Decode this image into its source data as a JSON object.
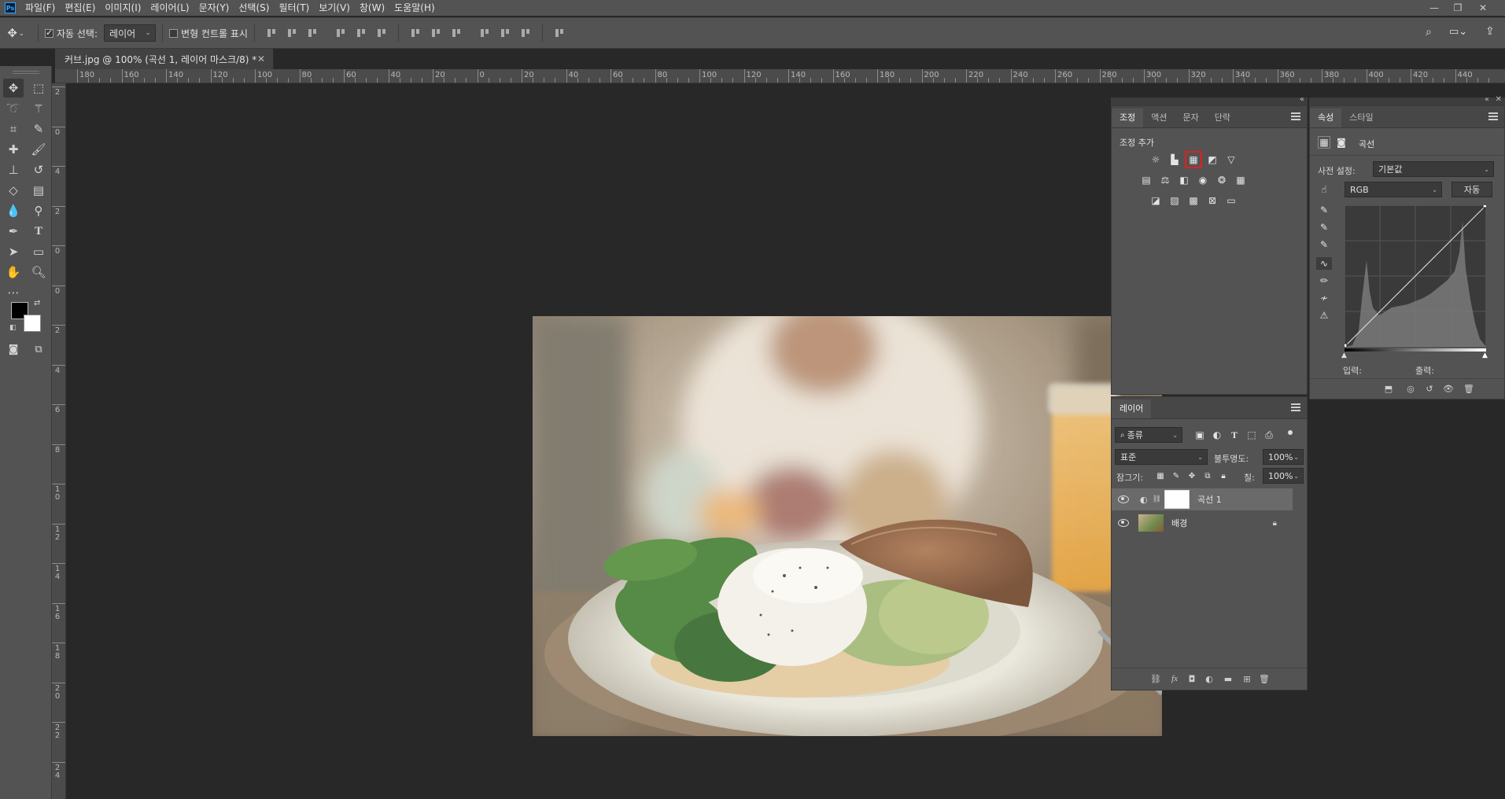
{
  "app": {
    "logo": "Ps"
  },
  "menubar": {
    "items": [
      {
        "label": "파일(F)"
      },
      {
        "label": "편집(E)"
      },
      {
        "label": "이미지(I)"
      },
      {
        "label": "레이어(L)"
      },
      {
        "label": "문자(Y)"
      },
      {
        "label": "선택(S)"
      },
      {
        "label": "필터(T)"
      },
      {
        "label": "보기(V)"
      },
      {
        "label": "창(W)"
      },
      {
        "label": "도움말(H)"
      }
    ]
  },
  "optionsbar": {
    "auto_select_label": "자동 선택:",
    "auto_select_checked": true,
    "auto_select_target": "레이어",
    "transform_controls_label": "변형 컨트롤 표시",
    "transform_controls_checked": false
  },
  "document_tab": {
    "title": "커브.jpg @ 100% (곡선 1, 레이어 마스크/8) *"
  },
  "ruler_h": {
    "labels": [
      "180",
      "160",
      "140",
      "120",
      "100",
      "80",
      "60",
      "40",
      "20",
      "0",
      "20",
      "40",
      "60",
      "80",
      "100",
      "120",
      "140",
      "160",
      "180",
      "200",
      "220",
      "240",
      "260",
      "280",
      "300",
      "320",
      "340",
      "360",
      "380",
      "400",
      "420",
      "440"
    ]
  },
  "ruler_v": {
    "labels": [
      "2",
      "0",
      "4",
      "2",
      "0",
      "0",
      "2",
      "4",
      "6",
      "8",
      "10",
      "12",
      "14",
      "16",
      "18",
      "20",
      "22",
      "24"
    ]
  },
  "adjustments_panel": {
    "tabs": [
      {
        "label": "조정",
        "active": true
      },
      {
        "label": "액션",
        "active": false
      },
      {
        "label": "문자",
        "active": false
      },
      {
        "label": "단락",
        "active": false
      }
    ],
    "heading": "조정 추가",
    "selected_icon": "curves-icon"
  },
  "properties_panel": {
    "tabs": [
      {
        "label": "속성",
        "active": true
      },
      {
        "label": "스타일",
        "active": false
      }
    ],
    "type_label": "곡선",
    "preset_label": "사전 설정:",
    "preset_value": "기본값",
    "channel_value": "RGB",
    "auto_button": "자동",
    "input_label": "입력:",
    "output_label": "출력:"
  },
  "layers_panel": {
    "tab": "레이어",
    "filter_kind": "종류",
    "blend_mode": "표준",
    "opacity_label": "불투명도:",
    "opacity_value": "100%",
    "lock_label": "잠그기:",
    "fill_label": "칠:",
    "fill_value": "100%",
    "layers": [
      {
        "name": "곡선 1",
        "selected": true,
        "locked": false
      },
      {
        "name": "배경",
        "selected": false,
        "locked": true
      }
    ]
  },
  "colors": {
    "foreground": "#000000",
    "background": "#ffffff",
    "highlight": "#e02020"
  }
}
